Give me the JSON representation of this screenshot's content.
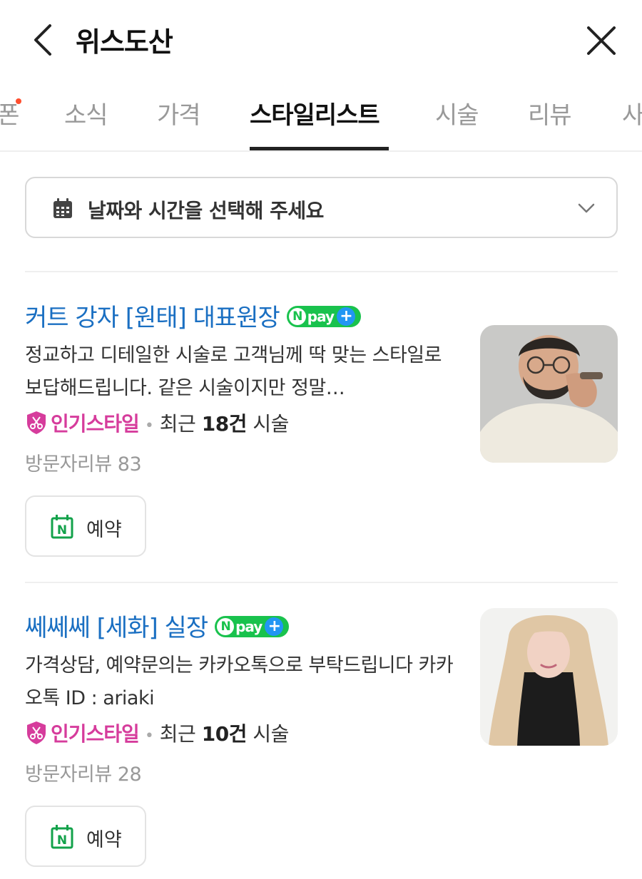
{
  "header": {
    "title": "위스도산"
  },
  "tabs": [
    {
      "label": "쿠폰",
      "active": false
    },
    {
      "label": "소식",
      "active": false
    },
    {
      "label": "가격",
      "active": false
    },
    {
      "label": "스타일리스트",
      "active": true
    },
    {
      "label": "시술",
      "active": false
    },
    {
      "label": "리뷰",
      "active": false
    },
    {
      "label": "사진",
      "active": false
    }
  ],
  "date_select": {
    "placeholder": "날짜와 시간을 선택해 주세요"
  },
  "colors": {
    "link_blue": "#1a6fc2",
    "popular_pink": "#d63c9c",
    "npay_green": "#19c24d",
    "npay_plus_blue": "#2196f3",
    "reserve_green": "#13a24b"
  },
  "stylists": [
    {
      "name": "커트 강자 [원태] 대표원장",
      "npay": "pay",
      "description": "정교하고 디테일한 시술로 고객님께 딱 맞는 스타일로 보답해드립니다. 같은 시술이지만 정말…",
      "popular_label": "인기스타일",
      "recent_prefix": "최근 ",
      "recent_count": "18건",
      "recent_suffix": " 시술",
      "reviews": "방문자리뷰 83",
      "reserve_label": "예약",
      "photo_icon": "male-stylist-portrait"
    },
    {
      "name": "쎄쎄쎄 [세화] 실장",
      "npay": "pay",
      "description": "가격상담, 예약문의는 카카오톡으로 부탁드립니다 카카오톡 ID : ariaki",
      "popular_label": "인기스타일",
      "recent_prefix": "최근 ",
      "recent_count": "10건",
      "recent_suffix": " 시술",
      "reviews": "방문자리뷰 28",
      "reserve_label": "예약",
      "photo_icon": "female-stylist-portrait"
    }
  ]
}
